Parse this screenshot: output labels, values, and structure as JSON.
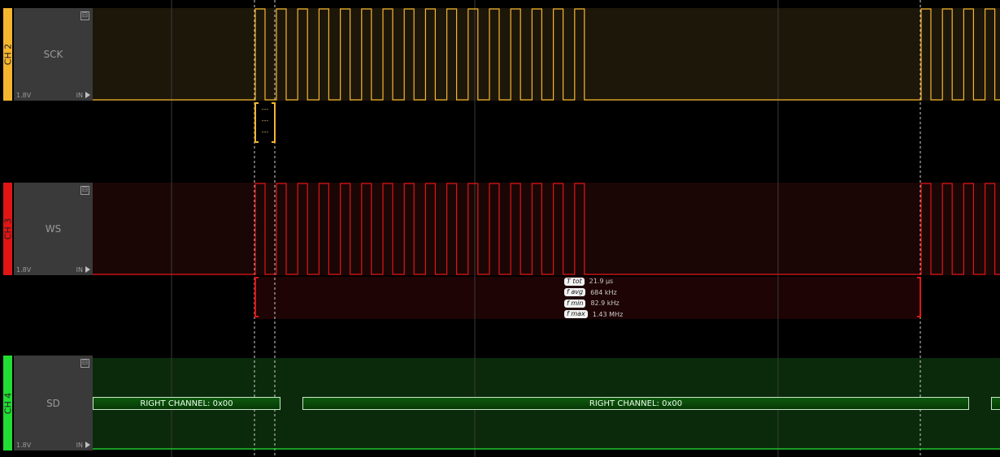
{
  "channels": [
    {
      "id": "CH 2",
      "signal": "SCK",
      "voltage": "1.8V",
      "dir": "IN",
      "color": "#f6b52f"
    },
    {
      "id": "CH 3",
      "signal": "WS",
      "voltage": "1.8V",
      "dir": "IN",
      "color": "#e01515"
    },
    {
      "id": "CH 4",
      "signal": "SD",
      "voltage": "1.8V",
      "dir": "IN",
      "color": "#22dd33"
    }
  ],
  "sck_annotation": {
    "lines": [
      "---",
      "---",
      "---"
    ]
  },
  "measurements": [
    {
      "badge": "T tot",
      "value": "21.9 µs"
    },
    {
      "badge": "f avg",
      "value": "684 kHz"
    },
    {
      "badge": "f min",
      "value": "82.9 kHz"
    },
    {
      "badge": "f max",
      "value": "1.43 MHz"
    }
  ],
  "decoder": {
    "frames": [
      {
        "label": "RIGHT CHANNEL: 0x00"
      },
      {
        "label": "RIGHT CHANNEL: 0x00"
      },
      {
        "label": ""
      }
    ]
  },
  "collapse_symbol": "⊟"
}
